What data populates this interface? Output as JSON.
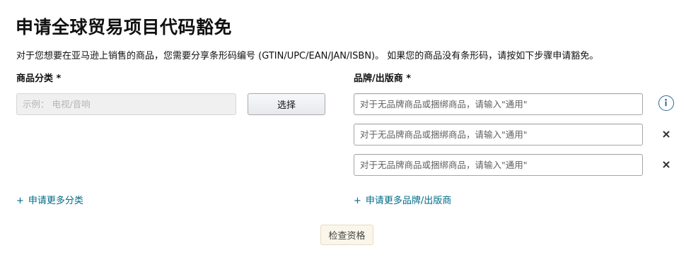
{
  "page": {
    "title": "申请全球贸易项目代码豁免",
    "intro": "对于您想要在亚马逊上销售的商品，您需要分享条形码编号 (GTIN/UPC/EAN/JAN/ISBN)。 如果您的商品没有条形码，请按如下步骤申请豁免。"
  },
  "category": {
    "label": "商品分类 *",
    "placeholder": "示例： 电视/音响",
    "value": "",
    "select_button": "选择",
    "add_more_link": "申请更多分类"
  },
  "brand": {
    "label": "品牌/出版商 *",
    "inputs": [
      {
        "placeholder": "对于无品牌商品或捆绑商品，请输入\"通用\"",
        "value": ""
      },
      {
        "placeholder": "对于无品牌商品或捆绑商品，请输入\"通用\"",
        "value": ""
      },
      {
        "placeholder": "对于无品牌商品或捆绑商品，请输入\"通用\"",
        "value": ""
      }
    ],
    "add_more_link": "申请更多品牌/出版商"
  },
  "add_prefix": "+",
  "check_button": "检查资格",
  "icons": {
    "info": "info-icon",
    "remove": "close-icon"
  },
  "colors": {
    "link": "#006b86",
    "info_icon": "#2a6b96",
    "check_button_bg": "#fbf6ea"
  }
}
